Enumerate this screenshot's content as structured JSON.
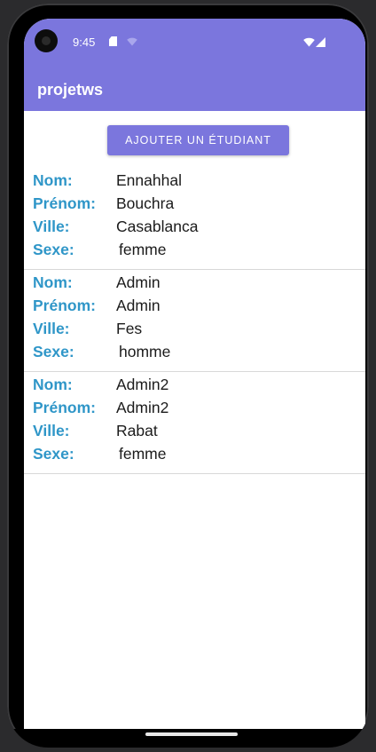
{
  "status_bar": {
    "time": "9:45",
    "color": "#7b76dd",
    "icons": [
      "sim-card-icon",
      "wifi-icon",
      "wifi-icon",
      "cell-signal-icon"
    ]
  },
  "app_bar": {
    "title": "projetws",
    "color": "#7b76dd"
  },
  "add_button": {
    "label": "AJOUTER UN ÉTUDIANT"
  },
  "labels": {
    "nom": "Nom:",
    "prenom": "Prénom:",
    "ville": "Ville:",
    "sexe": "Sexe:",
    "color": "#2f96c8"
  },
  "students": [
    {
      "nom": "Ennahhal",
      "prenom": "Bouchra",
      "ville": "Casablanca",
      "sexe": "femme"
    },
    {
      "nom": "Admin",
      "prenom": "Admin",
      "ville": "Fes",
      "sexe": "homme"
    },
    {
      "nom": "Admin2",
      "prenom": "Admin2",
      "ville": "Rabat",
      "sexe": "femme"
    }
  ]
}
